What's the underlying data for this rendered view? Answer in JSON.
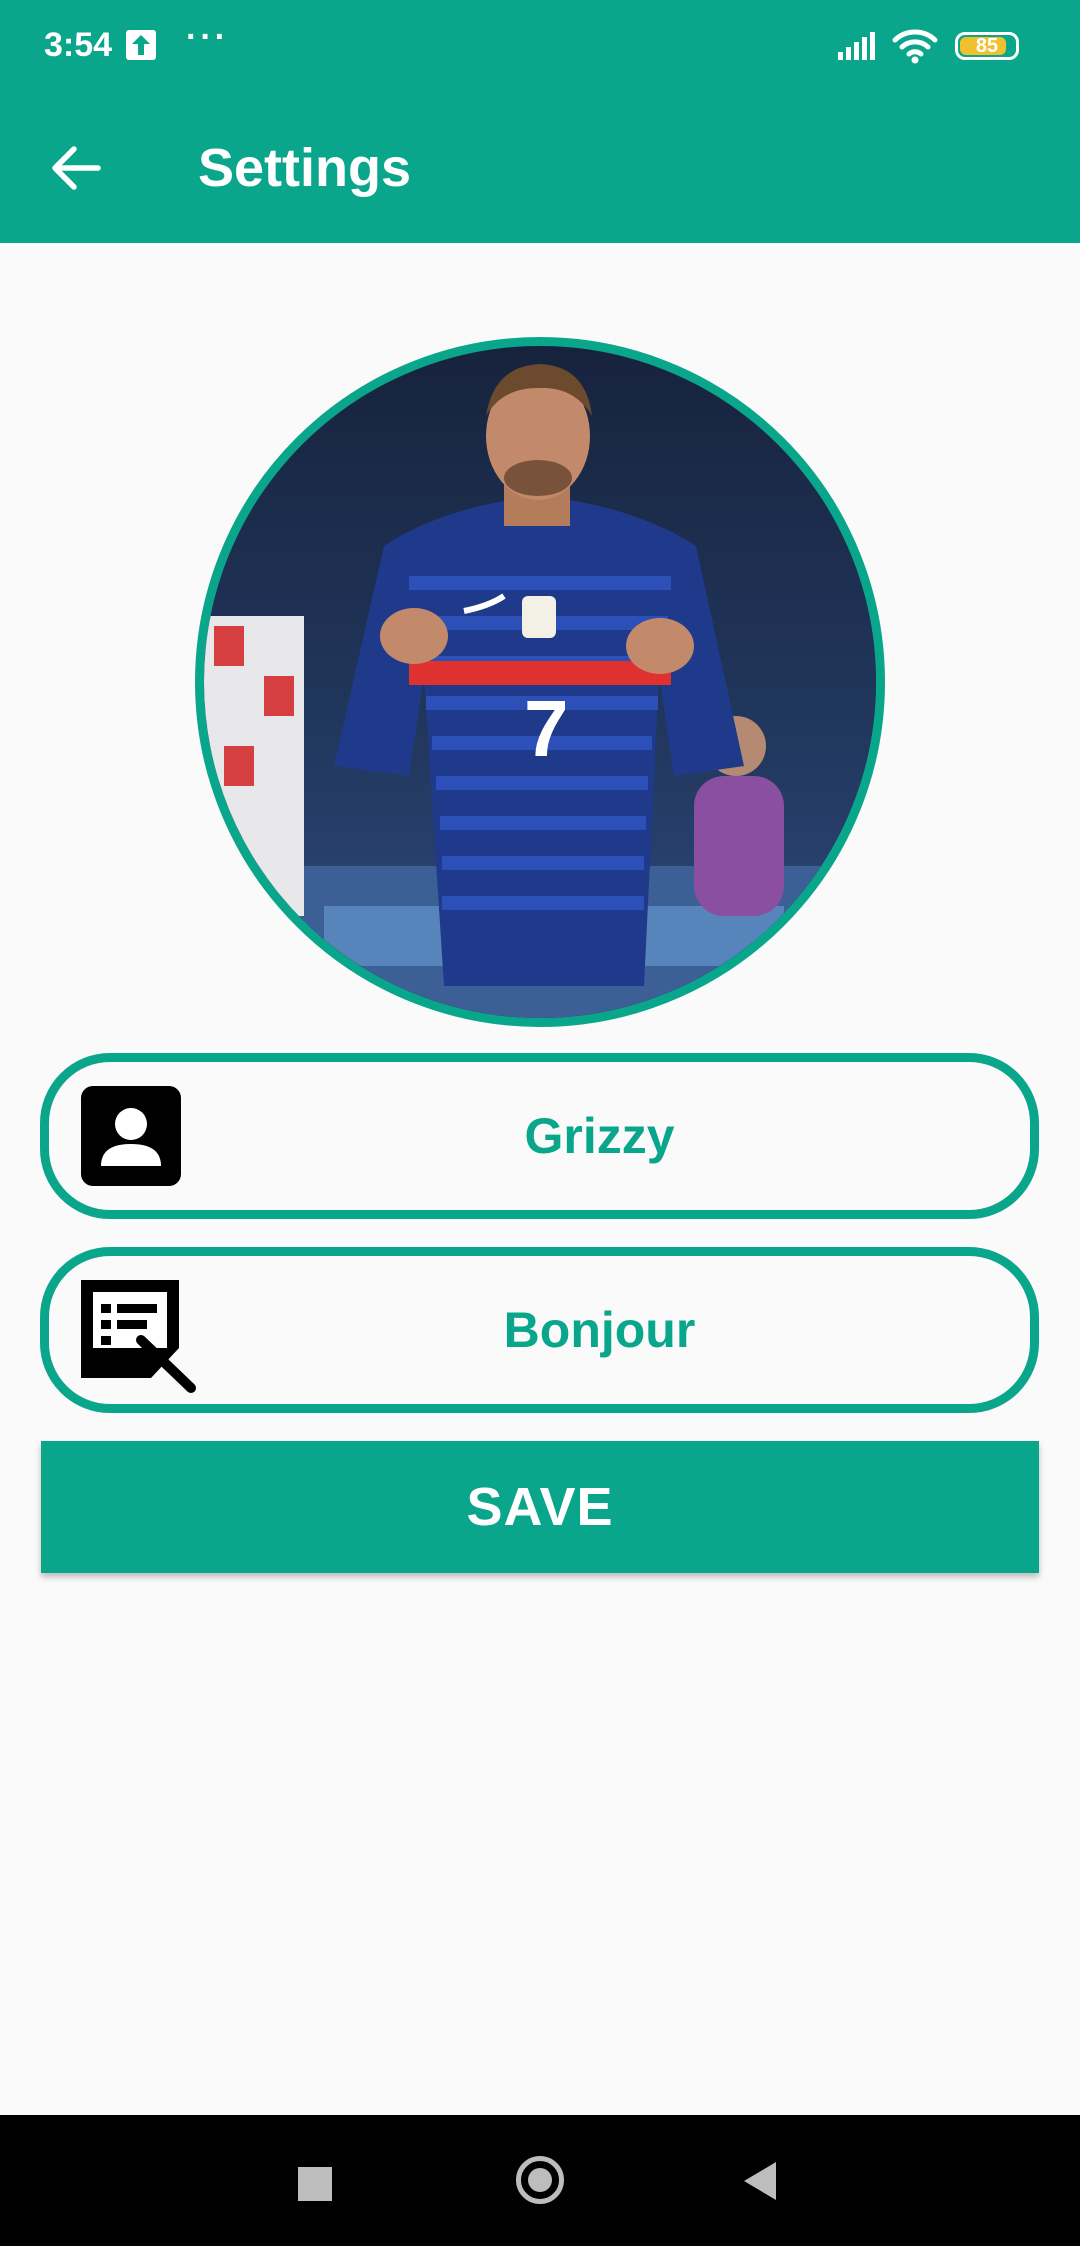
{
  "status_bar": {
    "time": "3:54",
    "battery": "85"
  },
  "app_bar": {
    "title": "Settings"
  },
  "profile": {
    "name": "Grizzy",
    "status": "Bonjour"
  },
  "save_label": "SAVE",
  "colors": {
    "accent": "#09a68c",
    "background": "#fafafa"
  },
  "icons": {
    "back": "arrow-back-icon",
    "name_field": "contact-card-icon",
    "status_field": "edit-note-icon",
    "nav_recents": "square-icon",
    "nav_home": "circle-icon",
    "nav_back": "triangle-back-icon"
  }
}
